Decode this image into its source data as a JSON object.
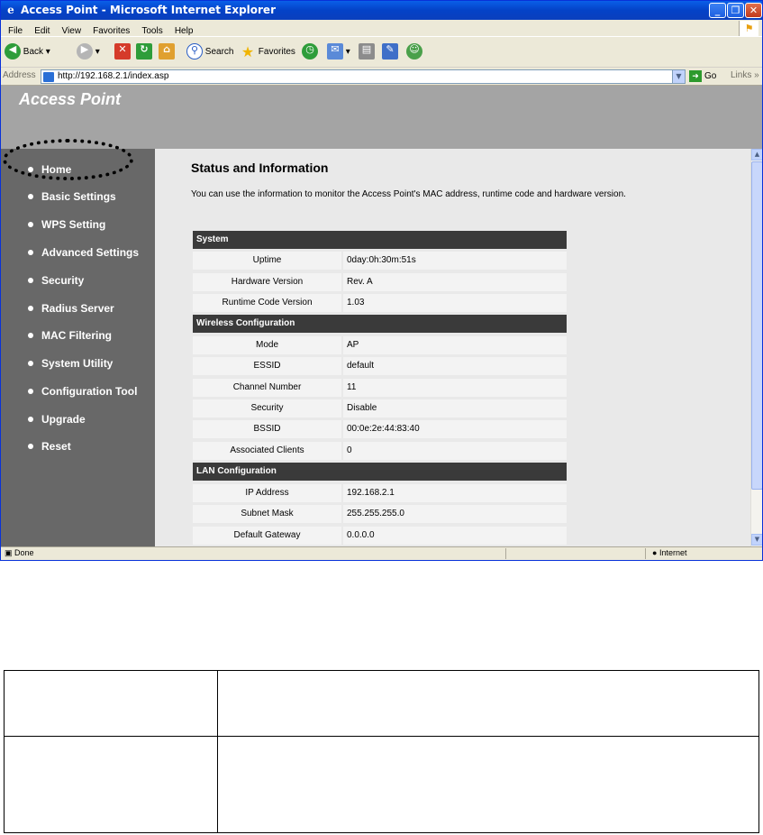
{
  "window": {
    "title": "Access Point - Microsoft Internet Explorer",
    "controls": [
      "_",
      "❐",
      "✕"
    ]
  },
  "menubar": [
    "File",
    "Edit",
    "View",
    "Favorites",
    "Tools",
    "Help"
  ],
  "toolbar": {
    "back": "Back",
    "search": "Search",
    "favorites": "Favorites"
  },
  "address": {
    "label": "Address",
    "url": "http://192.168.2.1/index.asp",
    "go": "Go",
    "links": "Links"
  },
  "page": {
    "banner_title": "Access Point",
    "nav": [
      "Home",
      "Basic Settings",
      "WPS Setting",
      "Advanced Settings",
      "Security",
      "Radius Server",
      "MAC Filtering",
      "System Utility",
      "Configuration Tool",
      "Upgrade",
      "Reset"
    ],
    "heading": "Status and Information",
    "description": "You can use the information to monitor the Access Point's MAC address, runtime code and hardware version.",
    "sections": [
      {
        "title": "System",
        "rows": [
          {
            "key": "Uptime",
            "value": "0day:0h:30m:51s"
          },
          {
            "key": "Hardware Version",
            "value": "Rev. A"
          },
          {
            "key": "Runtime Code Version",
            "value": "1.03"
          }
        ]
      },
      {
        "title": "Wireless Configuration",
        "rows": [
          {
            "key": "Mode",
            "value": "AP"
          },
          {
            "key": "ESSID",
            "value": "default"
          },
          {
            "key": "Channel Number",
            "value": "11"
          },
          {
            "key": "Security",
            "value": "Disable"
          },
          {
            "key": "BSSID",
            "value": "00:0e:2e:44:83:40"
          },
          {
            "key": "Associated Clients",
            "value": "0"
          }
        ]
      },
      {
        "title": "LAN Configuration",
        "rows": [
          {
            "key": "IP Address",
            "value": "192.168.2.1"
          },
          {
            "key": "Subnet Mask",
            "value": "255.255.255.0"
          },
          {
            "key": "Default Gateway",
            "value": "0.0.0.0"
          }
        ]
      }
    ]
  },
  "status": {
    "left": "Done",
    "zone": "Internet"
  },
  "colors": {
    "banner": "#a4a4a4",
    "sidebar": "#686868",
    "section_header": "#3a3a3a",
    "main_bg": "#e9e9e9"
  }
}
